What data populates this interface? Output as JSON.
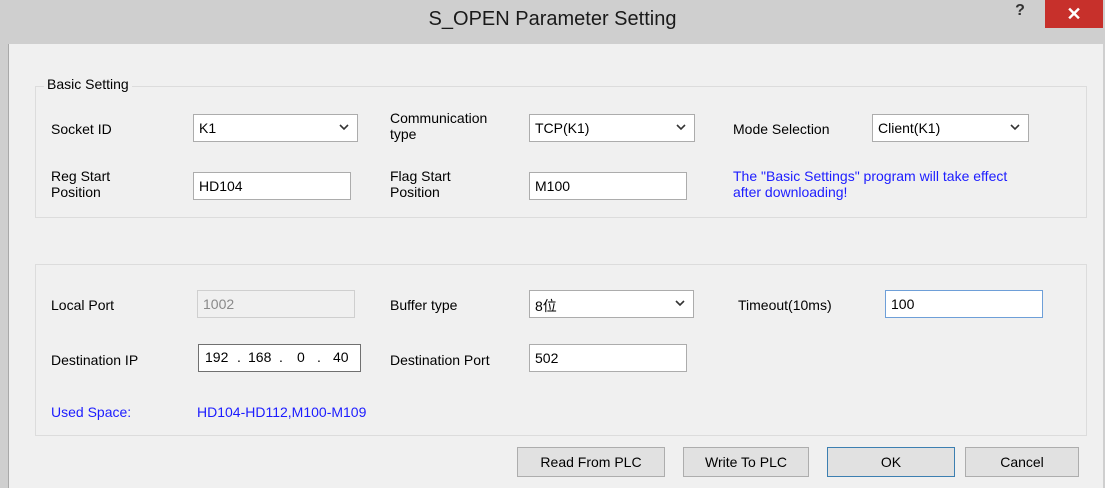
{
  "window": {
    "title": "S_OPEN Parameter Setting",
    "help_label": "?",
    "close_label": "✕"
  },
  "basic": {
    "group_label": "Basic Setting",
    "socket_id_label": "Socket ID",
    "socket_id_value": "K1",
    "comm_type_label_line1": "Communication",
    "comm_type_label_line2": "type",
    "comm_type_value": "TCP(K1)",
    "mode_label": "Mode Selection",
    "mode_value": "Client(K1)",
    "reg_start_label_line1": "Reg Start",
    "reg_start_label_line2": "Position",
    "reg_start_value": "HD104",
    "flag_start_label_line1": "Flag Start",
    "flag_start_label_line2": "Position",
    "flag_start_value": "M100",
    "notice_line1": "The \"Basic Settings\" program will take effect",
    "notice_line2": "after downloading!"
  },
  "conn": {
    "local_port_label": "Local Port",
    "local_port_value": "1002",
    "buffer_type_label": "Buffer type",
    "buffer_type_value": "8位",
    "timeout_label": "Timeout(10ms)",
    "timeout_value": "100",
    "dest_ip_label": "Destination IP",
    "dest_ip_octets": [
      "192",
      "168",
      "0",
      "40"
    ],
    "dest_ip_dot": ".",
    "dest_port_label": "Destination Port",
    "dest_port_value": "502",
    "used_space_label": "Used Space:",
    "used_space_value": "HD104-HD112,M100-M109"
  },
  "buttons": {
    "read": "Read From PLC",
    "write": "Write To PLC",
    "ok": "OK",
    "cancel": "Cancel"
  },
  "colors": {
    "accent_text": "#1c1cff",
    "close_button": "#c7302b"
  }
}
